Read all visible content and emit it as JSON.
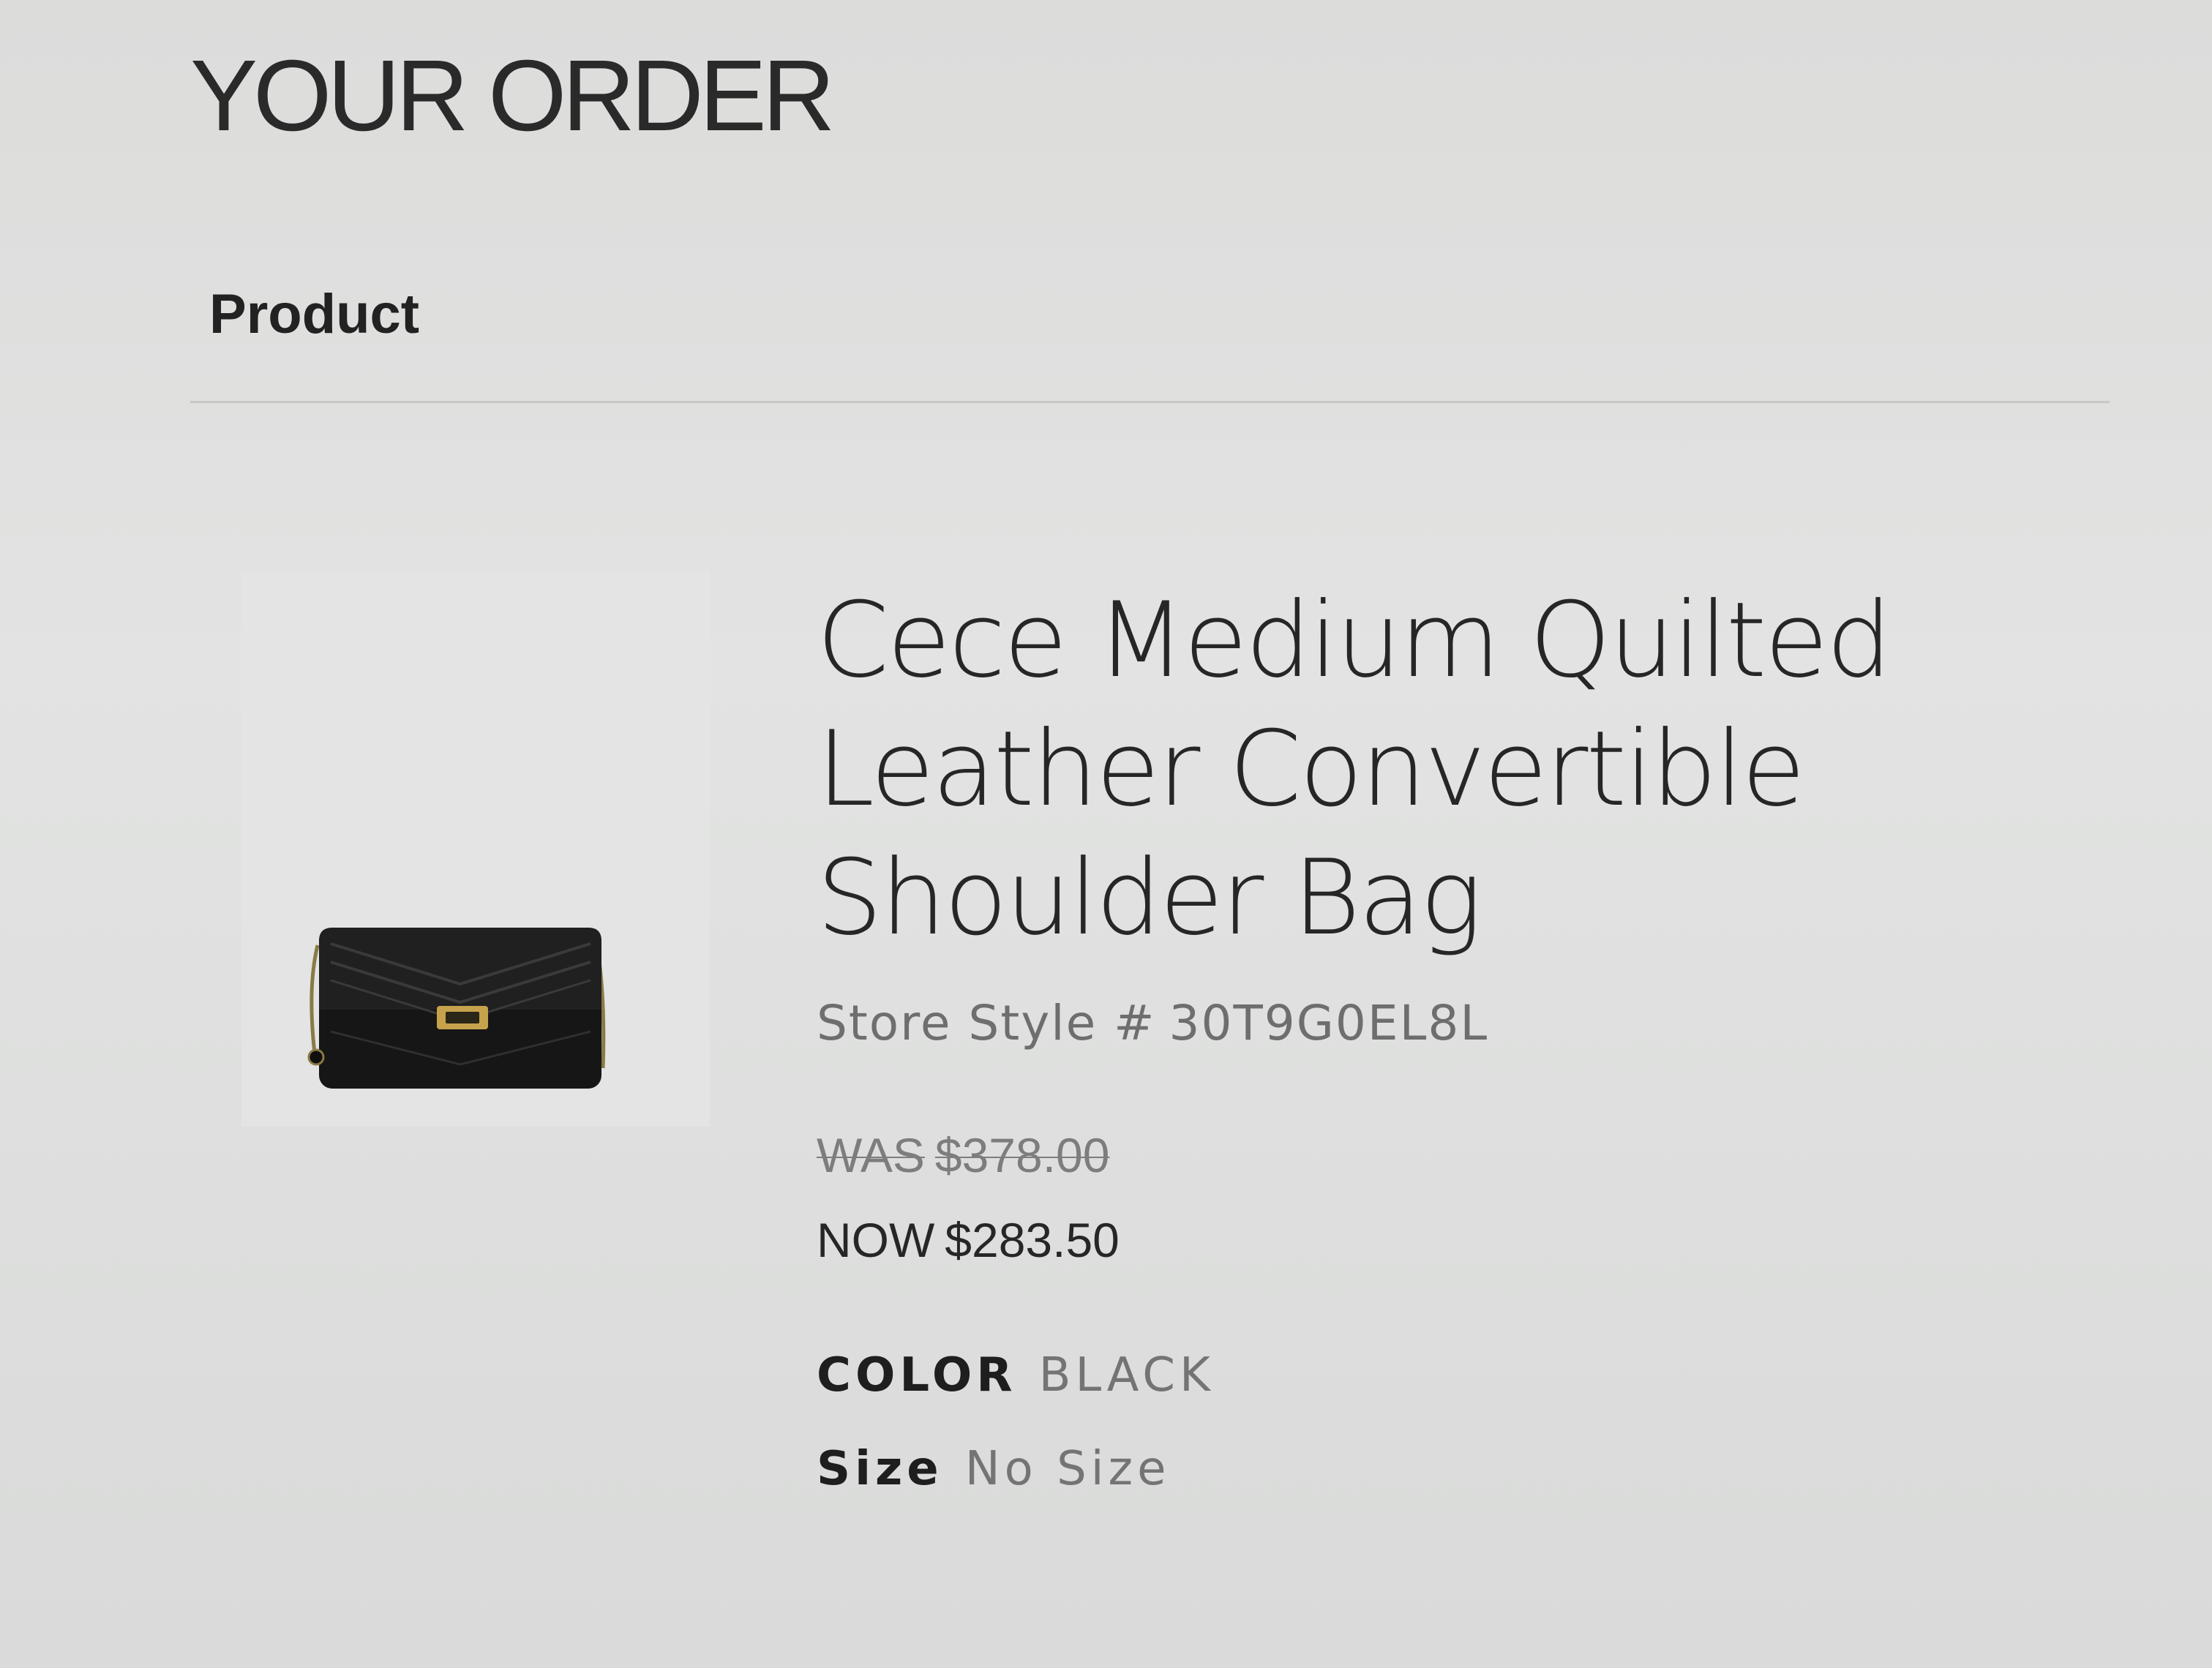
{
  "order": {
    "title": "YOUR ORDER",
    "column_header": "Product"
  },
  "product": {
    "name_lines": [
      "Cece Medium Quilted",
      "Leather Convertible",
      "Shoulder Bag"
    ],
    "style_label": "Store Style #",
    "style_number": "30T9G0EL8L",
    "was_label": "WAS",
    "was_price": "$378.00",
    "now_label": "NOW",
    "now_price": "$283.50",
    "color_label": "COLOR",
    "color_value": "BLACK",
    "size_label": "Size",
    "size_value": "No Size",
    "image_icon": "quilted-shoulder-bag-image"
  }
}
